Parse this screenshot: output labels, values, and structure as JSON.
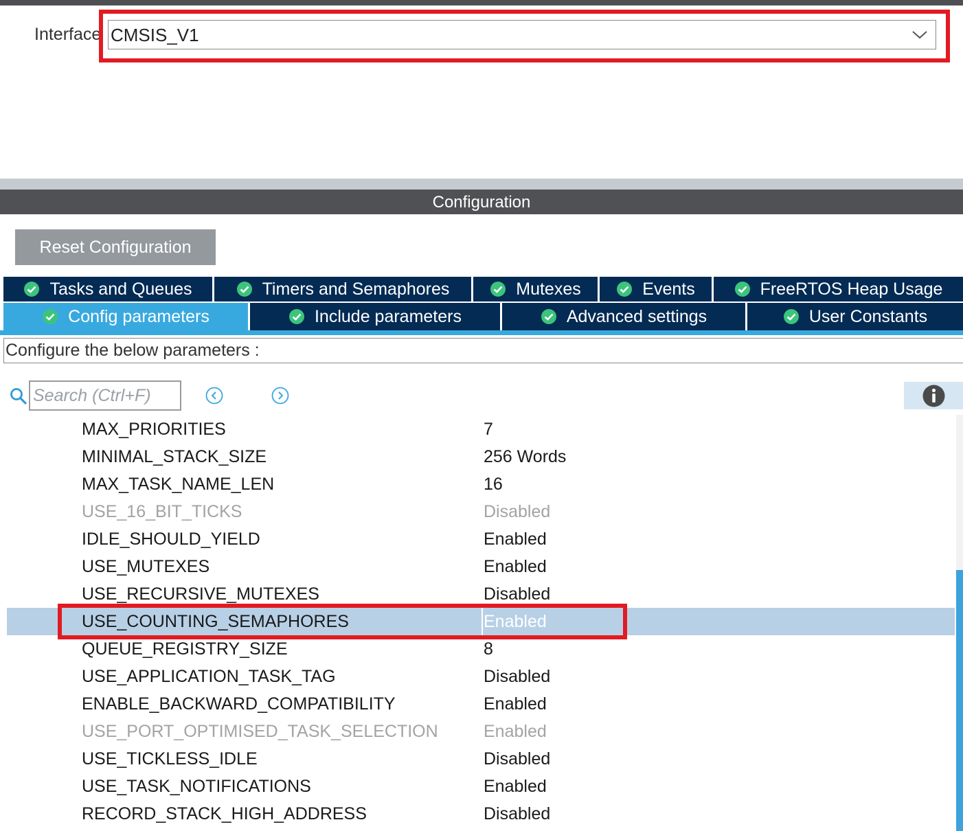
{
  "interface": {
    "label": "Interface",
    "selected": "CMSIS_V1"
  },
  "configuration": {
    "title": "Configuration",
    "reset_label": "Reset Configuration"
  },
  "tabs": {
    "row1": [
      {
        "label": "Tasks and Queues"
      },
      {
        "label": "Timers and Semaphores"
      },
      {
        "label": "Mutexes"
      },
      {
        "label": "Events"
      },
      {
        "label": "FreeRTOS Heap Usage"
      }
    ],
    "row2": [
      {
        "label": "Config parameters",
        "active": true
      },
      {
        "label": "Include parameters"
      },
      {
        "label": "Advanced settings"
      },
      {
        "label": "User Constants"
      }
    ]
  },
  "panel": {
    "configure_text": "Configure the below parameters :",
    "search_placeholder": "Search (Ctrl+F)"
  },
  "parameters": [
    {
      "name": "MAX_PRIORITIES",
      "value": "7"
    },
    {
      "name": "MINIMAL_STACK_SIZE",
      "value": "256 Words"
    },
    {
      "name": "MAX_TASK_NAME_LEN",
      "value": "16"
    },
    {
      "name": "USE_16_BIT_TICKS",
      "value": "Disabled",
      "disabled": true
    },
    {
      "name": "IDLE_SHOULD_YIELD",
      "value": "Enabled"
    },
    {
      "name": "USE_MUTEXES",
      "value": "Enabled"
    },
    {
      "name": "USE_RECURSIVE_MUTEXES",
      "value": "Disabled"
    },
    {
      "name": "USE_COUNTING_SEMAPHORES",
      "value": "Enabled",
      "selected": true
    },
    {
      "name": "QUEUE_REGISTRY_SIZE",
      "value": "8"
    },
    {
      "name": "USE_APPLICATION_TASK_TAG",
      "value": "Disabled"
    },
    {
      "name": "ENABLE_BACKWARD_COMPATIBILITY",
      "value": "Enabled"
    },
    {
      "name": "USE_PORT_OPTIMISED_TASK_SELECTION",
      "value": "Enabled",
      "disabled": true
    },
    {
      "name": "USE_TICKLESS_IDLE",
      "value": "Disabled"
    },
    {
      "name": "USE_TASK_NOTIFICATIONS",
      "value": "Enabled"
    },
    {
      "name": "RECORD_STACK_HIGH_ADDRESS",
      "value": "Disabled"
    }
  ],
  "colors": {
    "tab_dark": "#032b54",
    "tab_active": "#38a9df",
    "highlight_red": "#e21b22",
    "row_selected": "#b8d0e6"
  },
  "icons": {
    "tab_check": "check-circle-icon",
    "search": "search-icon",
    "prev": "chevron-left-circle-icon",
    "next": "chevron-right-circle-icon",
    "info": "info-icon",
    "dropdown": "chevron-down-icon"
  }
}
